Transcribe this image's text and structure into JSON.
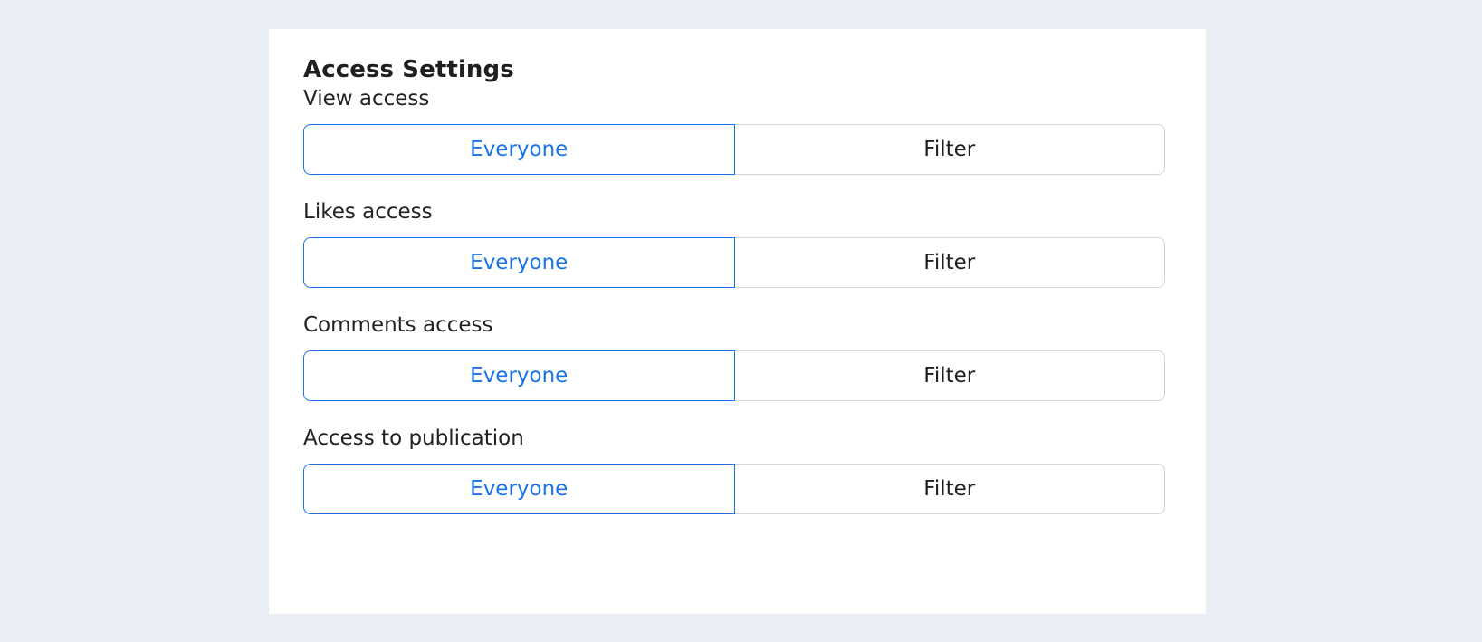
{
  "panel": {
    "title": "Access Settings"
  },
  "sections": [
    {
      "label": "View access",
      "options": [
        "Everyone",
        "Filter"
      ],
      "selected": "Everyone"
    },
    {
      "label": "Likes access",
      "options": [
        "Everyone",
        "Filter"
      ],
      "selected": "Everyone"
    },
    {
      "label": "Comments access",
      "options": [
        "Everyone",
        "Filter"
      ],
      "selected": "Everyone"
    },
    {
      "label": "Access to publication",
      "options": [
        "Everyone",
        "Filter"
      ],
      "selected": "Everyone"
    }
  ],
  "colors": {
    "background": "#e9eef5",
    "panel": "#ffffff",
    "accent": "#1a73e8",
    "border": "#d2d4d8",
    "text": "#222222"
  }
}
